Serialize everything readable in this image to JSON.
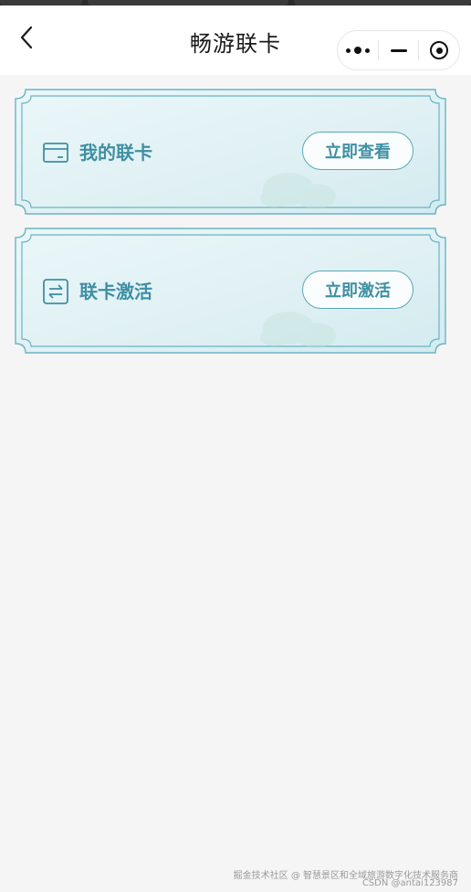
{
  "nav": {
    "title": "畅游联卡"
  },
  "cards": [
    {
      "label": "我的联卡",
      "button": "立即查看",
      "icon": "card-icon"
    },
    {
      "label": "联卡激活",
      "button": "立即激活",
      "icon": "exchange-icon"
    }
  ],
  "footer": {
    "watermark_line1": "掘金技术社区 @ 智慧景区和全域旅游数字化技术服务商",
    "watermark_line2": "CSDN @antai123987"
  },
  "colors": {
    "accent": "#3f8fa3",
    "frame": "#6ab3c4",
    "card_bg": "#e4f3f6",
    "page_bg": "#f5f5f5"
  }
}
